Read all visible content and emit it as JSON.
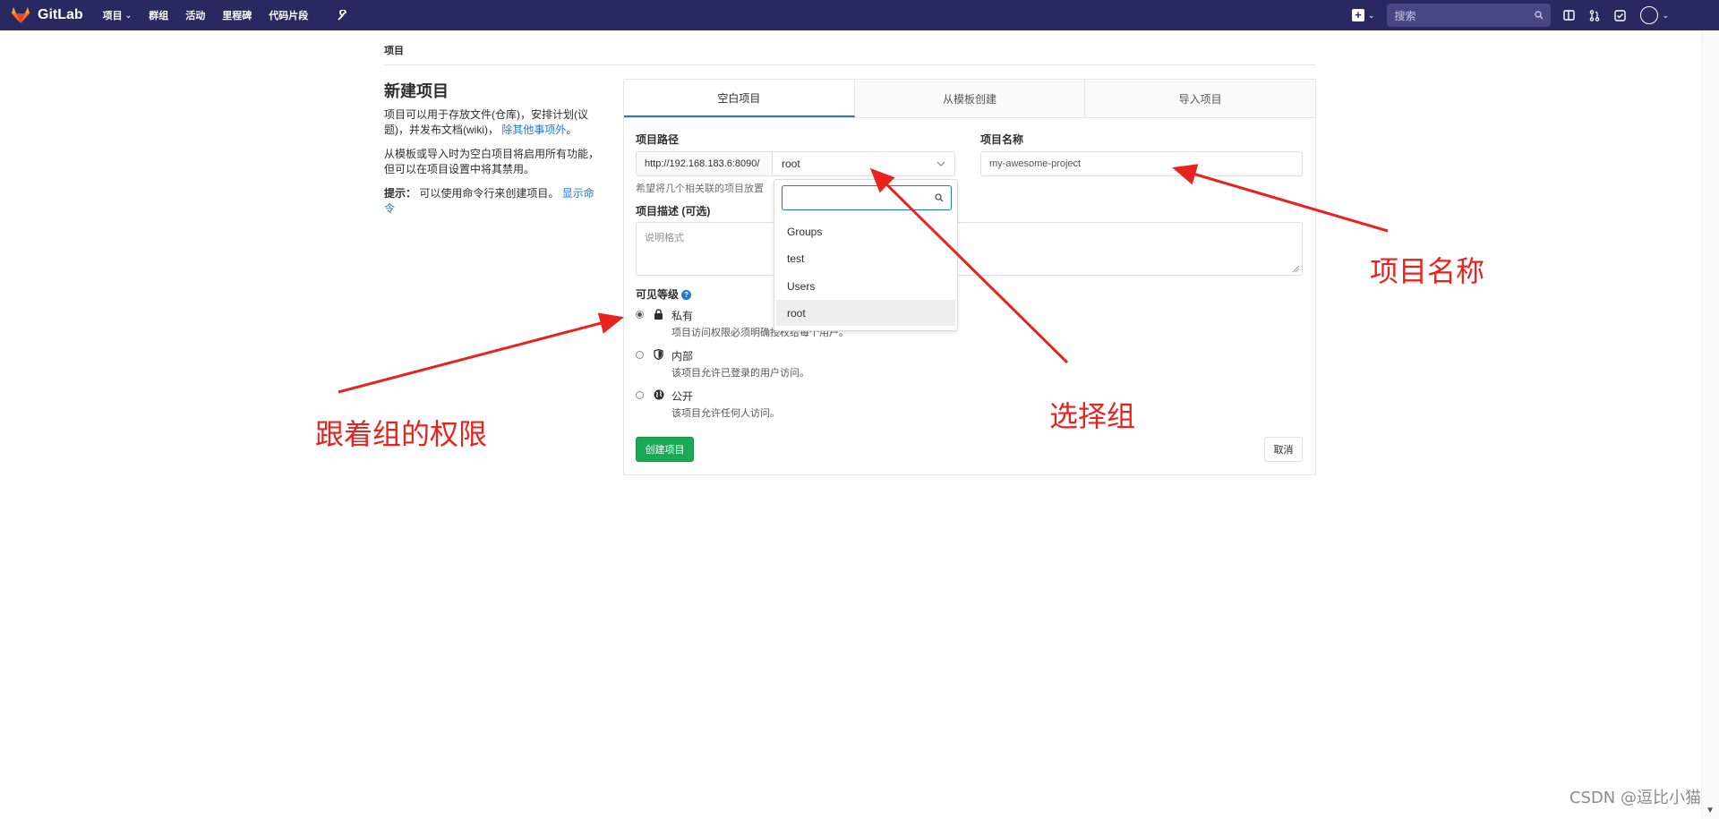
{
  "nav": {
    "brand": "GitLab",
    "links": [
      {
        "label": "项目",
        "has_dropdown": true
      },
      {
        "label": "群组"
      },
      {
        "label": "活动"
      },
      {
        "label": "里程碑"
      },
      {
        "label": "代码片段"
      }
    ],
    "search_placeholder": "搜索",
    "bg_color": "#292961"
  },
  "breadcrumb": "项目",
  "intro": {
    "title": "新建项目",
    "p1": "项目可以用于存放文件(仓库)，安排计划(议题)，并发布文档(wiki)，",
    "p1_link": "除其他事项外",
    "p1_end": "。",
    "p2": "从模板或导入时为空白项目将启用所有功能，但可以在项目设置中将其禁用。",
    "tip_label": "提示：",
    "tip_text": "可以使用命令行来创建项目。",
    "tip_link": "显示命令"
  },
  "tabs": [
    "空白项目",
    "从模板创建",
    "导入项目"
  ],
  "form": {
    "path_label": "项目路径",
    "url_prefix": "http://192.168.183.6:8090/",
    "namespace": "root",
    "name_label": "项目名称",
    "name_placeholder": "my-awesome-project",
    "help_text": "希望将几个相关联的项目放置",
    "desc_label": "项目描述 (可选)",
    "desc_placeholder": "说明格式",
    "visibility_label": "可见等级",
    "visibility": [
      {
        "title": "私有",
        "desc": "项目访问权限必须明确授权给每个用户。",
        "checked": true,
        "icon": "lock-icon"
      },
      {
        "title": "内部",
        "desc": "该项目允许已登录的用户访问。",
        "checked": false,
        "icon": "shield-icon"
      },
      {
        "title": "公开",
        "desc": "该项目允许任何人访问。",
        "checked": false,
        "icon": "globe-icon"
      }
    ],
    "create_label": "创建项目",
    "cancel_label": "取消"
  },
  "dropdown": {
    "items": [
      {
        "label": "Groups",
        "type": "header"
      },
      {
        "label": "test",
        "type": "item"
      },
      {
        "label": "Users",
        "type": "header"
      },
      {
        "label": "root",
        "type": "item",
        "selected": true
      }
    ]
  },
  "annotations": {
    "project_name": "项目名称",
    "select_group": "选择组",
    "follow_group": "跟着组的权限",
    "color": "#e8231e"
  },
  "watermark": "CSDN @逗比小猫"
}
